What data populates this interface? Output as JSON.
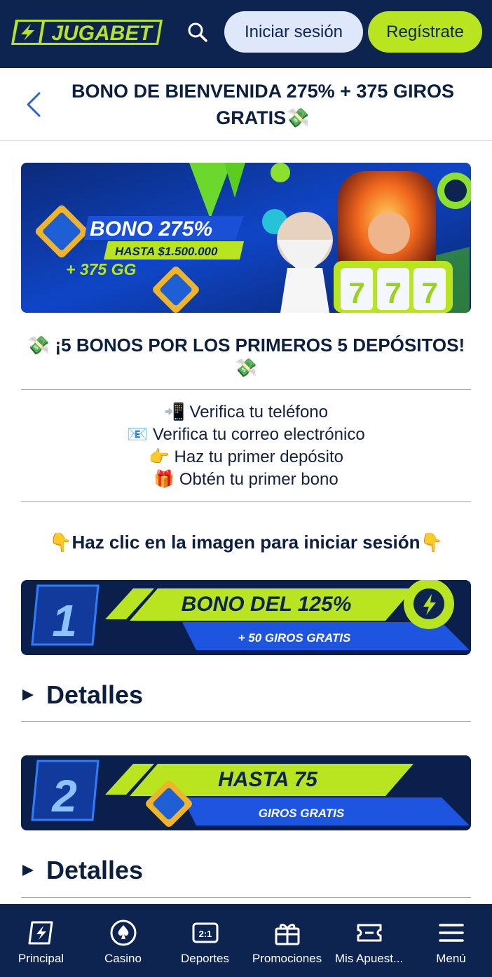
{
  "header": {
    "logo_text": "JUGABET",
    "login_label": "Iniciar sesión",
    "register_label": "Regístrate",
    "colors": {
      "navy": "#0d2451",
      "lime": "#b8e520",
      "login_bg": "#dfe7fb"
    }
  },
  "title": {
    "text": "BONO DE BIENVENIDA 275% + 375 GIROS GRATIS💸"
  },
  "hero": {
    "bono": "BONO 275%",
    "hasta": "HASTA $1.500.000",
    "gg": "+ 375 GG"
  },
  "headline": "💸 ¡5 BONOS POR LOS PRIMEROS 5 DEPÓSITOS! 💸",
  "steps": [
    "📲 Verifica tu teléfono",
    "📧 Verifica tu correo electrónico",
    "👉 Haz tu primer depósito",
    "🎁 Obtén tu primer bono"
  ],
  "cta": "👇Haz clic en la imagen para iniciar sesión👇",
  "promos": [
    {
      "number": "1",
      "main": "BONO DEL 125%",
      "sub": "+ 50 GIROS GRATIS"
    },
    {
      "number": "2",
      "main": "HASTA 75",
      "sub": "GIROS GRATIS"
    }
  ],
  "details_label": "Detalles",
  "nav": [
    {
      "label": "Principal",
      "icon": "bolt-icon"
    },
    {
      "label": "Casino",
      "icon": "spade-chip-icon"
    },
    {
      "label": "Deportes",
      "icon": "odds-icon"
    },
    {
      "label": "Promociones",
      "icon": "gift-icon"
    },
    {
      "label": "Mis Apuest...",
      "icon": "ticket-icon"
    },
    {
      "label": "Menú",
      "icon": "hamburger-icon"
    }
  ]
}
